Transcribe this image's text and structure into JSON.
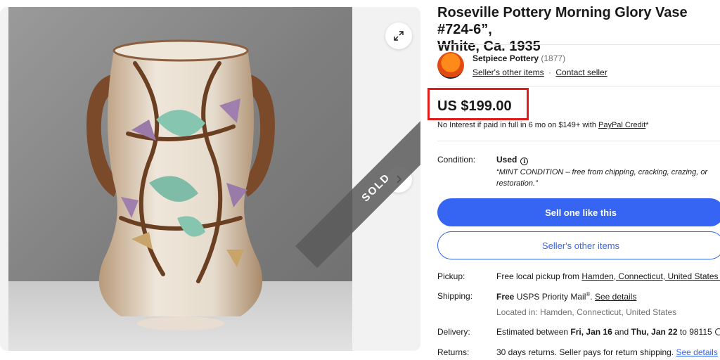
{
  "listing": {
    "title": "Roseville Pottery Morning Glory Vase #724-6”,\nWhite, Ca. 1935",
    "sold_label": "SOLD"
  },
  "seller": {
    "name": "Setpiece Pottery",
    "feedback": "(1877)",
    "other_items_link": "Seller's other items",
    "separator": "·",
    "contact_link": "Contact seller"
  },
  "price": {
    "amount": "US $199.00",
    "credit_prefix": "No Interest if paid in full in 6 mo on $149+ with ",
    "credit_link": "PayPal Credit",
    "credit_suffix": "*"
  },
  "condition": {
    "label": "Condition:",
    "value": "Used",
    "quote": "“MINT CONDITION – free from chipping, cracking, crazing, or restoration.”"
  },
  "buttons": {
    "sell_one": "Sell one like this",
    "seller_other_items": "Seller's other items"
  },
  "pickup": {
    "label": "Pickup:",
    "prefix": "Free local pickup from ",
    "location_link": "Hamden, Connecticut, United States 0"
  },
  "shipping": {
    "label": "Shipping:",
    "free": "Free",
    "service": " USPS Priority Mail",
    "reg": "®",
    "dot": ". ",
    "details_link": "See details",
    "located": "Located in: Hamden, Connecticut, United States"
  },
  "delivery": {
    "label": "Delivery:",
    "prefix": "Estimated between ",
    "start": "Fri, Jan 16",
    "and": " and ",
    "end": "Thu, Jan 22",
    "to": " to 98115"
  },
  "returns": {
    "label": "Returns:",
    "text": "30 days returns. Seller pays for return shipping. ",
    "details_link": "See details"
  },
  "colors": {
    "accent_blue": "#3665f3",
    "highlight_red": "#e21b1b"
  },
  "icons": [
    "expand-icon",
    "chevron-right-icon",
    "info-icon",
    "clock-icon"
  ]
}
